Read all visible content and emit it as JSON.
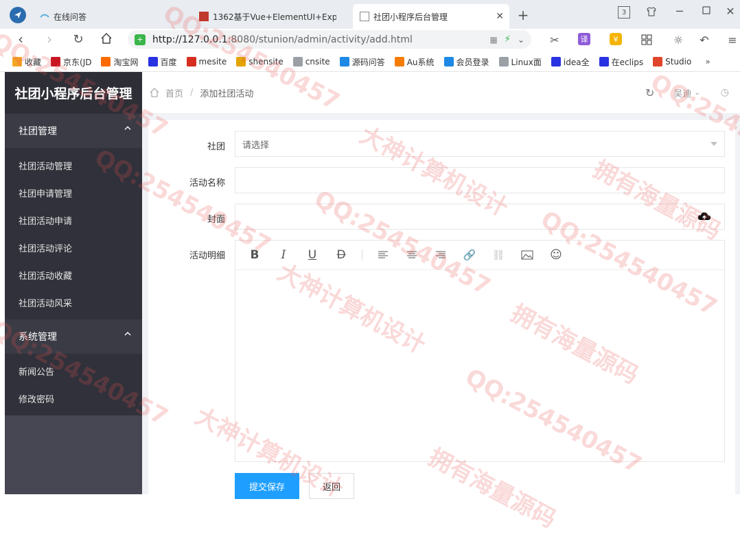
{
  "browser": {
    "tabs": [
      {
        "label": "在线问答"
      },
      {
        "label": "1362基于Vue+ElementUI+Exp"
      },
      {
        "label": "社团小程序后台管理"
      }
    ],
    "tab_count_badge": "3",
    "url_host": "http://127.0.0.1",
    "url_path": ":8080/stunion/admin/activity/add.html",
    "bookmarks": [
      {
        "label": "收藏",
        "color": "#f5a623"
      },
      {
        "label": "京东(JD",
        "color": "#c81623"
      },
      {
        "label": "淘宝网",
        "color": "#ff6a00"
      },
      {
        "label": "百度",
        "color": "#2932e1"
      },
      {
        "label": "mesite",
        "color": "#d62d20"
      },
      {
        "label": "shensite",
        "color": "#e4a400"
      },
      {
        "label": "cnsite",
        "color": "#9aa0a6"
      },
      {
        "label": "源码问答",
        "color": "#1e88e5"
      },
      {
        "label": "Au系统",
        "color": "#f57c00"
      },
      {
        "label": "会员登录",
        "color": "#1e88e5"
      },
      {
        "label": "Linux面",
        "color": "#9aa0a6"
      },
      {
        "label": "idea全",
        "color": "#2932e1"
      },
      {
        "label": "在eclips",
        "color": "#2932e1"
      },
      {
        "label": "Studio",
        "color": "#e0452c"
      }
    ],
    "bookmarks_more": "»"
  },
  "sidebar": {
    "brand": "社团小程序后台管理",
    "group1": "社团管理",
    "group1_items": [
      "社团活动管理",
      "社团申请管理",
      "社团活动申请",
      "社团活动评论",
      "社团活动收藏",
      "社团活动风采"
    ],
    "group2": "系统管理",
    "group2_items": [
      "新闻公告",
      "修改密码"
    ]
  },
  "header": {
    "breadcrumb_home": "首页",
    "breadcrumb_sep": "/",
    "breadcrumb_current": "添加社团活动",
    "user": "吴迪"
  },
  "form": {
    "club_label": "社团",
    "club_placeholder": "请选择",
    "name_label": "活动名称",
    "cover_label": "封面",
    "detail_label": "活动明细",
    "submit": "提交保存",
    "back": "返回"
  },
  "colors": {
    "primary": "#1e9fff",
    "sidebar": "#30313a",
    "sidebar_group": "#3a3b45"
  },
  "watermarks": [
    "QQ:254540457",
    "大神计算机设计",
    "拥有海量源码"
  ]
}
